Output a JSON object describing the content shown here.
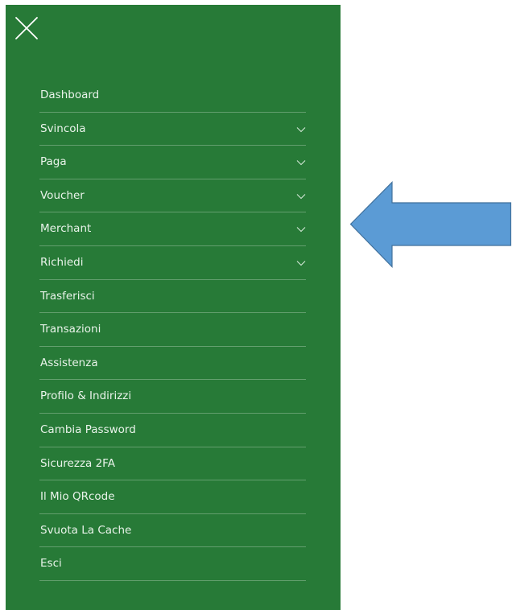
{
  "drawer": {
    "background": "#277a37",
    "close_icon": "close-icon",
    "items": [
      {
        "label": "Dashboard",
        "has_submenu": false
      },
      {
        "label": "Svincola",
        "has_submenu": true
      },
      {
        "label": "Paga",
        "has_submenu": true
      },
      {
        "label": "Voucher",
        "has_submenu": true
      },
      {
        "label": "Merchant",
        "has_submenu": true
      },
      {
        "label": "Richiedi",
        "has_submenu": true
      },
      {
        "label": "Trasferisci",
        "has_submenu": false
      },
      {
        "label": "Transazioni",
        "has_submenu": false
      },
      {
        "label": "Assistenza",
        "has_submenu": false
      },
      {
        "label": "Profilo & Indirizzi",
        "has_submenu": false
      },
      {
        "label": "Cambia Password",
        "has_submenu": false
      },
      {
        "label": "Sicurezza 2FA",
        "has_submenu": false
      },
      {
        "label": "Il Mio QRcode",
        "has_submenu": false
      },
      {
        "label": "Svuota La Cache",
        "has_submenu": false
      },
      {
        "label": "Esci",
        "has_submenu": false
      }
    ]
  },
  "annotation": {
    "icon": "left-arrow-icon",
    "fill": "#5b9bd5",
    "stroke": "#41719c"
  }
}
